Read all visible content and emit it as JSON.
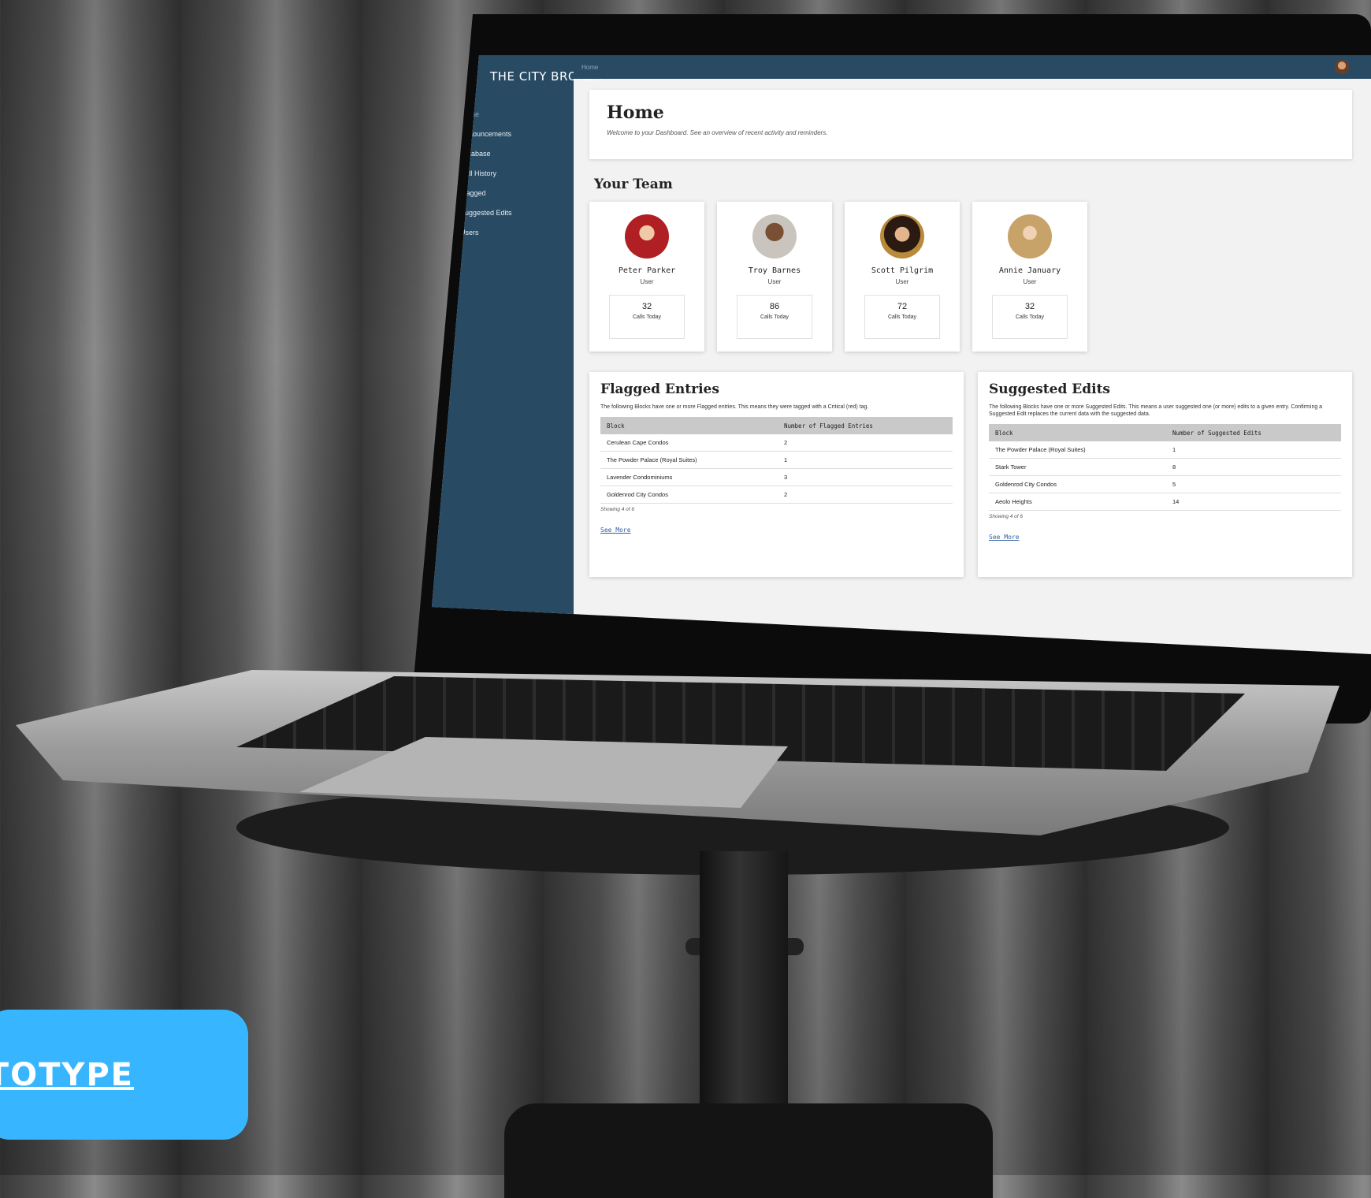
{
  "app": {
    "brand": "THE CITY BROKER",
    "breadcrumb": "Home"
  },
  "sidebar": {
    "items": [
      {
        "label": "Home",
        "icon": "home-icon",
        "active": true
      },
      {
        "label": "Announcements",
        "icon": "info-icon",
        "active": false
      },
      {
        "label": "Database",
        "icon": "database-icon",
        "active": false
      },
      {
        "label": "Call History",
        "icon": "history-icon",
        "active": false
      },
      {
        "label": "Flagged",
        "icon": "flag-icon",
        "active": false
      },
      {
        "label": "Suggested Edits",
        "icon": "edit-icon",
        "active": false
      },
      {
        "label": "Users",
        "icon": "users-icon",
        "active": false
      }
    ]
  },
  "home": {
    "title": "Home",
    "subtitle": "Welcome to your Dashboard. See an overview of recent activity and reminders."
  },
  "team": {
    "title": "Your Team",
    "members": [
      {
        "name": "Peter Parker",
        "role": "User",
        "calls": "32",
        "calls_label": "Calls Today"
      },
      {
        "name": "Troy Barnes",
        "role": "User",
        "calls": "86",
        "calls_label": "Calls Today"
      },
      {
        "name": "Scott Pilgrim",
        "role": "User",
        "calls": "72",
        "calls_label": "Calls Today"
      },
      {
        "name": "Annie January",
        "role": "User",
        "calls": "32",
        "calls_label": "Calls Today"
      }
    ]
  },
  "flagged": {
    "title": "Flagged Entries",
    "description": "The following Blocks have one or more Flagged entries. This means they were tagged with a Critical (red) tag.",
    "columns": [
      "Block",
      "Number of Flagged Entries"
    ],
    "rows": [
      [
        "Cerulean Cape Condos",
        "2"
      ],
      [
        "The Powder Palace (Royal Suites)",
        "1"
      ],
      [
        "Lavender Condominiums",
        "3"
      ],
      [
        "Goldenrod City Condos",
        "2"
      ]
    ],
    "showing": "Showing 4 of 6",
    "see_more": "See More"
  },
  "suggested": {
    "title": "Suggested Edits",
    "description": "The following Blocks have one or more Suggested Edits. This means a user suggested one (or more) edits to a given entry. Confirming a Suggested Edit replaces the current data with the suggested data.",
    "columns": [
      "Block",
      "Number of Suggested Edits"
    ],
    "rows": [
      [
        "The Powder Palace (Royal Suites)",
        "1"
      ],
      [
        "Stark Tower",
        "8"
      ],
      [
        "Goldenrod City Condos",
        "5"
      ],
      [
        "Aeolo Heights",
        "14"
      ]
    ],
    "showing": "Showing 4 of 6",
    "see_more": "See More"
  },
  "badge": {
    "label": "PROTOTYPE"
  },
  "colors": {
    "sidebar": "#284a63",
    "badge": "#37b6ff",
    "table_header": "#c9c9c9"
  }
}
